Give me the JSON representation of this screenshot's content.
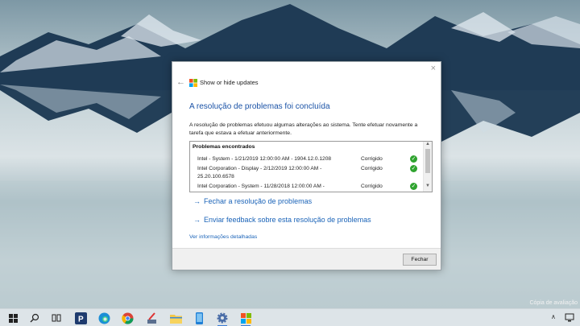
{
  "window": {
    "app_title": "Show or hide updates",
    "close_glyph": "×",
    "back_glyph": "←",
    "heading": "A resolução de problemas foi concluída",
    "description": "A resolução de problemas efetuou algumas alterações ao sistema. Tente efetuar novamente a tarefa que estava a efetuar anteriormente.",
    "problems": {
      "header": "Problemas encontrados",
      "rows": [
        {
          "text": "Intel - System - 1/21/2019 12:00:00 AM - 1904.12.0.1208",
          "status": "Corrigido"
        },
        {
          "text": "Intel Corporation - Display - 2/12/2019 12:00:00 AM - 25.20.100.6578",
          "status": "Corrigido"
        },
        {
          "text": "Intel Corporation - System - 11/28/2018 12:00:00 AM -",
          "status": "Corrigido"
        }
      ]
    },
    "links": {
      "close_troubleshooting": "Fechar a resolução de problemas",
      "send_feedback": "Enviar feedback sobre esta resolução de problemas",
      "details": "Ver informações detalhadas"
    },
    "footer": {
      "close_button": "Fechar"
    }
  },
  "watermark": "Cópia de avaliação",
  "taskbar": {
    "icons": [
      "windows-start-icon",
      "search-icon",
      "task-view-icon",
      "p-app-icon",
      "edge-icon",
      "chrome-icon",
      "tool-icon",
      "file-explorer-icon",
      "phone-icon",
      "settings-icon",
      "show-hide-updates-icon"
    ]
  },
  "colors": {
    "accent": "#1a63b8",
    "heading": "#1a52a6",
    "ok": "#2fa32f"
  }
}
